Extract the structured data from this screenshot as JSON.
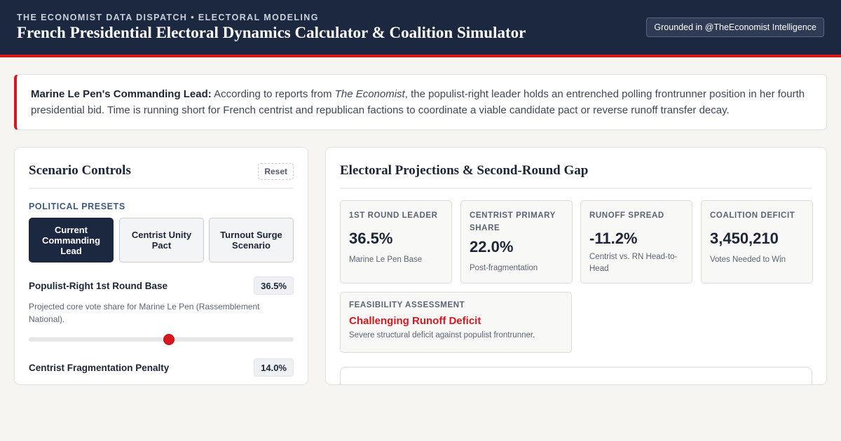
{
  "header": {
    "kicker": "THE ECONOMIST DATA DISPATCH • ELECTORAL MODELING",
    "title": "French Presidential Electoral Dynamics Calculator & Coalition Simulator",
    "badge": "Grounded in @TheEconomist Intelligence"
  },
  "callout": {
    "lead": "Marine Le Pen's Commanding Lead:",
    "text_before": " According to reports from ",
    "source": "The Economist",
    "text_after": ", the populist-right leader holds an entrenched polling frontrunner position in her fourth presidential bid. Time is running short for French centrist and republican factions to coordinate a viable candidate pact or reverse runoff transfer decay."
  },
  "controls": {
    "title": "Scenario Controls",
    "reset_label": "Reset",
    "presets_label": "POLITICAL PRESETS",
    "presets": [
      {
        "label": "Current Commanding Lead",
        "active": true
      },
      {
        "label": "Centrist Unity Pact",
        "active": false
      },
      {
        "label": "Turnout Surge Scenario",
        "active": false
      }
    ],
    "sliders": [
      {
        "label": "Populist-Right 1st Round Base",
        "value": "36.5%",
        "description": "Projected core vote share for Marine Le Pen (Rassemblement National).",
        "position": 0.53
      },
      {
        "label": "Centrist Fragmentation Penalty",
        "value": "14.0%"
      }
    ]
  },
  "projections": {
    "title": "Electoral Projections & Second-Round Gap",
    "stats": [
      {
        "label": "1ST ROUND LEADER",
        "value": "36.5%",
        "sub": "Marine Le Pen Base"
      },
      {
        "label": "CENTRIST PRIMARY SHARE",
        "value": "22.0%",
        "sub": "Post-fragmentation"
      },
      {
        "label": "RUNOFF SPREAD",
        "value": "-11.2%",
        "sub": "Centrist vs. RN Head-to-Head"
      },
      {
        "label": "COALITION DEFICIT",
        "value": "3,450,210",
        "sub": "Votes Needed to Win"
      }
    ],
    "feasibility": {
      "label": "FEASIBILITY ASSESSMENT",
      "value": "Challenging Runoff Deficit",
      "description": "Severe structural deficit against populist frontrunner."
    }
  },
  "colors": {
    "navy": "#1c2740",
    "accent_red": "#d7191f",
    "background": "#f6f5f1"
  }
}
